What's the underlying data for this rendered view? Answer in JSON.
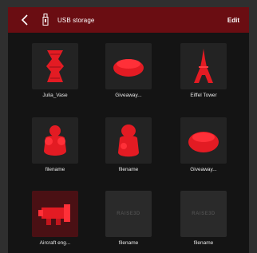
{
  "header": {
    "title": "USB storage",
    "edit_label": "Edit"
  },
  "colors": {
    "topbar": "#6a0d12",
    "accent": "#e31b23",
    "background": "#141414"
  },
  "files": [
    {
      "label": "Julia_Vase",
      "icon": "vase-model-icon"
    },
    {
      "label": "Giveaway...",
      "icon": "round-model-icon"
    },
    {
      "label": "Eiffel Tower",
      "icon": "eiffel-tower-model-icon"
    },
    {
      "label": "filename",
      "icon": "figure-model-icon"
    },
    {
      "label": "filename",
      "icon": "figure-model-icon"
    },
    {
      "label": "Giveaway...",
      "icon": "round-model-icon"
    },
    {
      "label": "Aircraft eng...",
      "icon": "engine-model-icon"
    },
    {
      "label": "filename",
      "icon": "no-preview-icon",
      "placeholder_text": "RAISE3D"
    },
    {
      "label": "filename",
      "icon": "no-preview-icon",
      "placeholder_text": "RAISE3D"
    }
  ]
}
